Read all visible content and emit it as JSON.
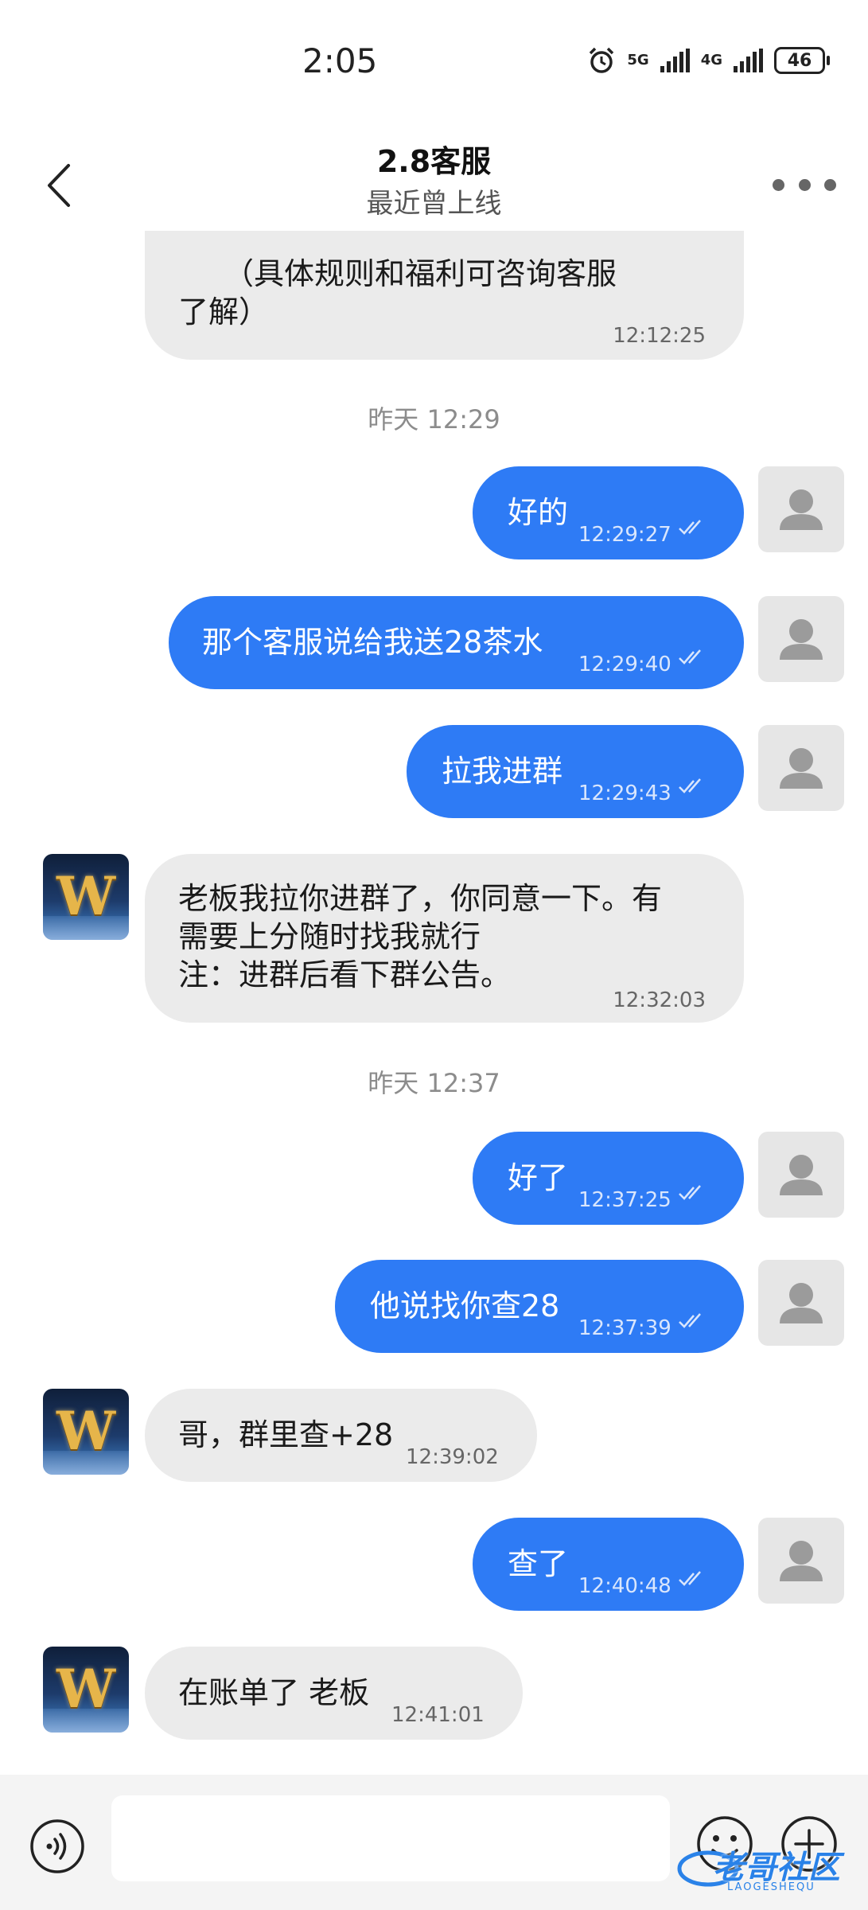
{
  "status_bar": {
    "time": "2:05",
    "net1": "5G",
    "net2": "4G",
    "battery": "46"
  },
  "header": {
    "title": "2.8客服",
    "subtitle": "最近曾上线"
  },
  "timestamps": [
    "昨天 12:29",
    "昨天 12:37"
  ],
  "messages": [
    {
      "side": "in",
      "lines": [
        "　　（具体规则和福利可咨询客服",
        "了解）"
      ],
      "time": "12:12:25"
    },
    {
      "side": "out",
      "text": "好的",
      "time": "12:29:27"
    },
    {
      "side": "out",
      "text": "那个客服说给我送28茶水",
      "time": "12:29:40"
    },
    {
      "side": "out",
      "text": "拉我进群",
      "time": "12:29:43"
    },
    {
      "side": "in",
      "lines": [
        "老板我拉你进群了，你同意一下。有",
        "需要上分随时找我就行",
        "注：进群后看下群公告。"
      ],
      "time": "12:32:03"
    },
    {
      "side": "out",
      "text": "好了",
      "time": "12:37:25"
    },
    {
      "side": "out",
      "text": "他说找你查28",
      "time": "12:37:39"
    },
    {
      "side": "in",
      "text": "哥，群里查+28",
      "time": "12:39:02"
    },
    {
      "side": "out",
      "text": "查了",
      "time": "12:40:48"
    },
    {
      "side": "in",
      "text": "在账单了 老板",
      "time": "12:41:01"
    }
  ],
  "avatar_letter": "W",
  "input": {
    "placeholder": ""
  },
  "watermark": {
    "text": "老哥社区",
    "sub": "LAOGESHEQU"
  },
  "colors": {
    "outgoing_bubble": "#2e7bf5",
    "incoming_bubble": "#ebebeb",
    "background": "#ffffff"
  }
}
